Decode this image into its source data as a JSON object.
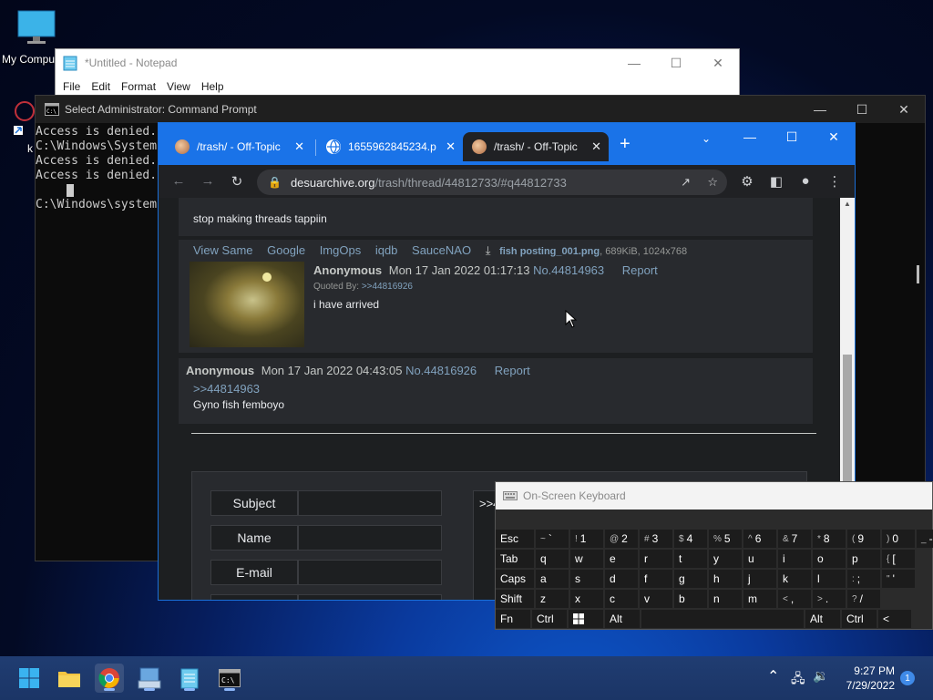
{
  "desktop": {
    "icons": [
      {
        "label": "My Compu"
      },
      {
        "label": "k"
      }
    ]
  },
  "notepad": {
    "title": "*Untitled - Notepad",
    "menu": [
      "File",
      "Edit",
      "Format",
      "View",
      "Help"
    ]
  },
  "cmd": {
    "title": "Select Administrator: Command Prompt",
    "lines": [
      "Access is denied.",
      "C:\\Windows\\System",
      "Access is denied.",
      "Access is denied.",
      "",
      "C:\\Windows\\system"
    ]
  },
  "chrome": {
    "tabs": [
      {
        "title": "/trash/ - Off-Topic",
        "active": false
      },
      {
        "title": "1655962845234.p",
        "active": false
      },
      {
        "title": "/trash/ - Off-Topic",
        "active": true
      }
    ],
    "new_tab": "+",
    "url_domain": "desuarchive.org",
    "url_path": "/trash/thread/44812733/#q44812733",
    "posts": {
      "p1": {
        "text": "stop making threads tappiin"
      },
      "p2": {
        "links": [
          "View Same",
          "Google",
          "ImgOps",
          "iqdb",
          "SauceNAO"
        ],
        "file_name": "fish posting_001.png",
        "file_meta": ", 689KiB, 1024x768",
        "name": "Anonymous",
        "date": "Mon 17 Jan 2022 01:17:13",
        "no": "No.44814963",
        "report": "Report",
        "quoted_by_label": "Quoted By:",
        "quoted_by": ">>44816926",
        "text": "i have arrived"
      },
      "p3": {
        "name": "Anonymous",
        "date": "Mon 17 Jan 2022 04:43:05",
        "no": "No.44816926",
        "report": "Report",
        "quote": ">>44814963",
        "text": "Gyno fish femboyo"
      }
    },
    "form": {
      "labels": [
        "Subject",
        "Name",
        "E-mail"
      ],
      "comment_prefix": ">>4"
    }
  },
  "osk": {
    "title": "On-Screen Keyboard",
    "rows": [
      [
        {
          "k": "Esc"
        },
        {
          "s": "~",
          "k": "`"
        },
        {
          "s": "!",
          "k": "1"
        },
        {
          "s": "@",
          "k": "2"
        },
        {
          "s": "#",
          "k": "3"
        },
        {
          "s": "$",
          "k": "4"
        },
        {
          "s": "%",
          "k": "5"
        },
        {
          "s": "^",
          "k": "6"
        },
        {
          "s": "&",
          "k": "7"
        },
        {
          "s": "*",
          "k": "8"
        },
        {
          "s": "(",
          "k": "9"
        },
        {
          "s": ")",
          "k": "0"
        },
        {
          "s": "_",
          "k": "-"
        }
      ],
      [
        {
          "k": "Tab"
        },
        {
          "k": "q"
        },
        {
          "k": "w"
        },
        {
          "k": "e"
        },
        {
          "k": "r"
        },
        {
          "k": "t"
        },
        {
          "k": "y"
        },
        {
          "k": "u"
        },
        {
          "k": "i"
        },
        {
          "k": "o"
        },
        {
          "k": "p"
        },
        {
          "s": "{",
          "k": "["
        }
      ],
      [
        {
          "k": "Caps"
        },
        {
          "k": "a"
        },
        {
          "k": "s"
        },
        {
          "k": "d"
        },
        {
          "k": "f"
        },
        {
          "k": "g"
        },
        {
          "k": "h"
        },
        {
          "k": "j"
        },
        {
          "k": "k"
        },
        {
          "k": "l"
        },
        {
          "s": ":",
          "k": ";"
        },
        {
          "s": "\"",
          "k": "'"
        }
      ],
      [
        {
          "k": "Shift"
        },
        {
          "k": "z"
        },
        {
          "k": "x"
        },
        {
          "k": "c"
        },
        {
          "k": "v"
        },
        {
          "k": "b"
        },
        {
          "k": "n"
        },
        {
          "k": "m"
        },
        {
          "s": "<",
          "k": ","
        },
        {
          "s": ">",
          "k": "."
        },
        {
          "s": "?",
          "k": "/"
        }
      ],
      [
        {
          "k": "Fn"
        },
        {
          "k": "Ctrl"
        },
        {
          "k": "windows-key"
        },
        {
          "k": "Alt"
        },
        {
          "k": ""
        },
        {
          "k": "Alt"
        },
        {
          "k": "Ctrl"
        },
        {
          "k": "<"
        }
      ]
    ]
  },
  "taskbar": {
    "time": "9:27 PM",
    "date": "7/29/2022",
    "notifications": "1"
  },
  "colors": {
    "chrome_accent": "#1a73e8",
    "link": "#81a2be",
    "post_bg": "#282a2e"
  }
}
